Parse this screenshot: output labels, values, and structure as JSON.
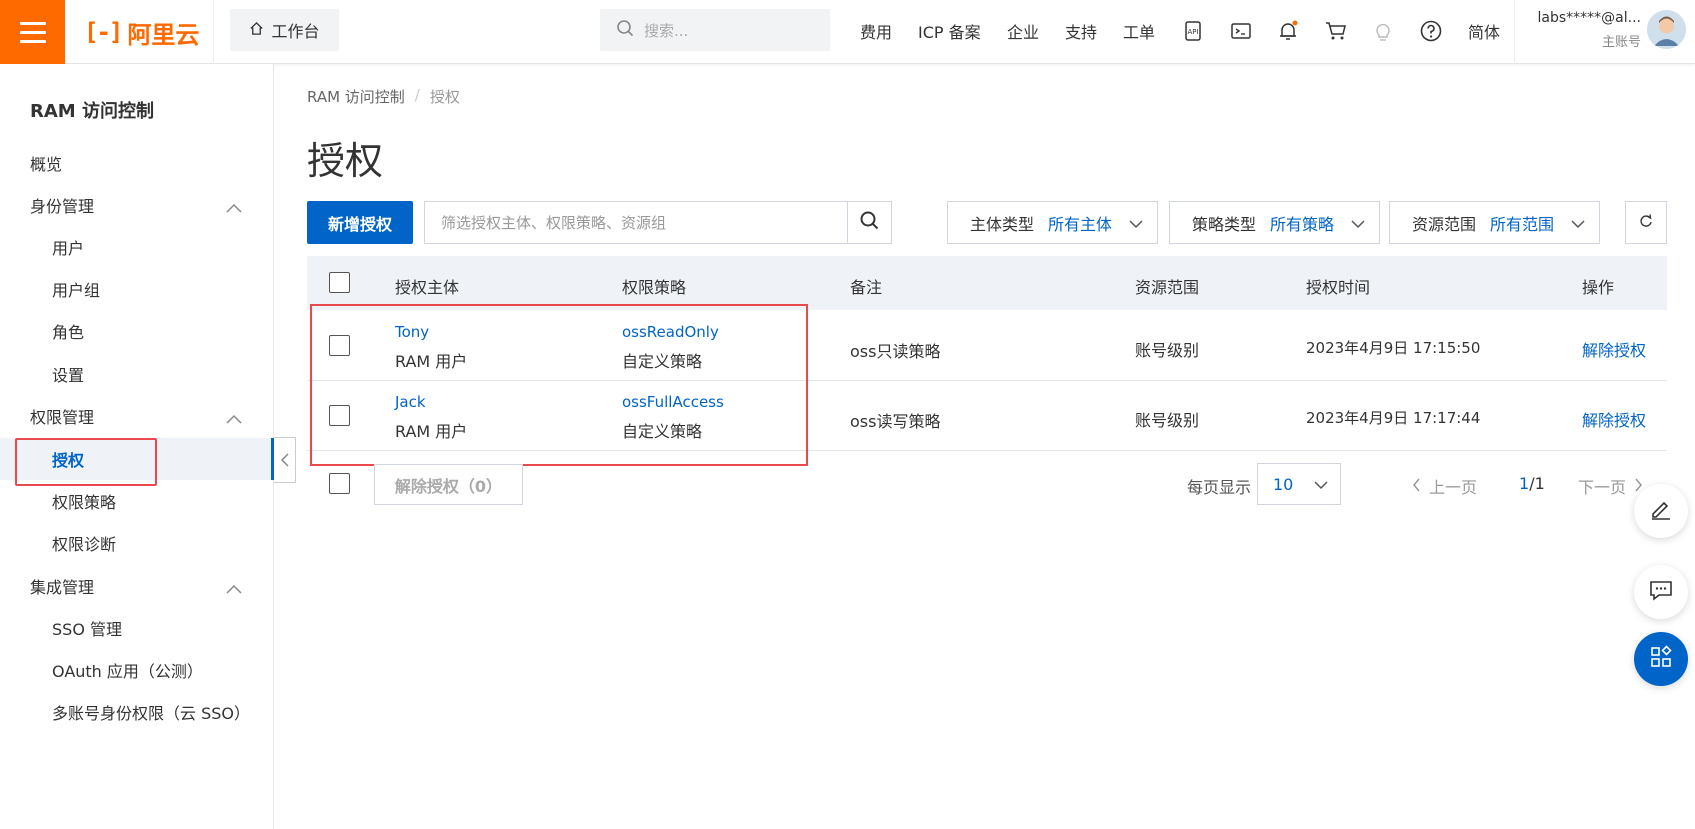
{
  "topbar": {
    "logo_text": "阿里云",
    "workbench_label": "工作台",
    "search_placeholder": "搜索...",
    "nav": [
      "费用",
      "ICP 备案",
      "企业",
      "支持",
      "工单"
    ],
    "lang": "简体",
    "user_name": "labs*****@al...",
    "user_sub": "主账号",
    "accent_color": "#ff6a00"
  },
  "sidebar": {
    "title": "RAM 访问控制",
    "items": [
      {
        "label": "概览"
      },
      {
        "label": "身份管理"
      },
      {
        "label": "用户"
      },
      {
        "label": "用户组"
      },
      {
        "label": "角色"
      },
      {
        "label": "设置"
      },
      {
        "label": "权限管理"
      },
      {
        "label": "授权"
      },
      {
        "label": "权限策略"
      },
      {
        "label": "权限诊断"
      },
      {
        "label": "集成管理"
      },
      {
        "label": "SSO 管理"
      },
      {
        "label": "OAuth 应用（公测）"
      },
      {
        "label": "多账号身份权限（云 SSO）"
      }
    ]
  },
  "main": {
    "breadcrumb": [
      "RAM 访问控制",
      "授权"
    ],
    "title": "授权",
    "add_button": "新增授权",
    "filter_placeholder": "筛选授权主体、权限策略、资源组",
    "filters": [
      {
        "key": "主体类型",
        "value": "所有主体"
      },
      {
        "key": "策略类型",
        "value": "所有策略"
      },
      {
        "key": "资源范围",
        "value": "所有范围"
      }
    ],
    "primary_color": "#0064c8"
  },
  "table": {
    "columns": [
      "授权主体",
      "权限策略",
      "备注",
      "资源范围",
      "授权时间",
      "操作"
    ],
    "rows": [
      {
        "principal": "Tony",
        "principal_type": "RAM 用户",
        "policy": "ossReadOnly",
        "policy_type": "自定义策略",
        "note": "oss只读策略",
        "scope": "账号级别",
        "time": "2023年4月9日 17:15:50",
        "action": "解除授权"
      },
      {
        "principal": "Jack",
        "principal_type": "RAM 用户",
        "policy": "ossFullAccess",
        "policy_type": "自定义策略",
        "note": "oss读写策略",
        "scope": "账号级别",
        "time": "2023年4月9日 17:17:44",
        "action": "解除授权"
      }
    ]
  },
  "footer": {
    "bulk_revoke": "解除授权（0）",
    "page_size_label": "每页显示",
    "page_size": "10",
    "prev": "上一页",
    "page_current": "1",
    "page_total": "/1",
    "next": "下一页"
  }
}
